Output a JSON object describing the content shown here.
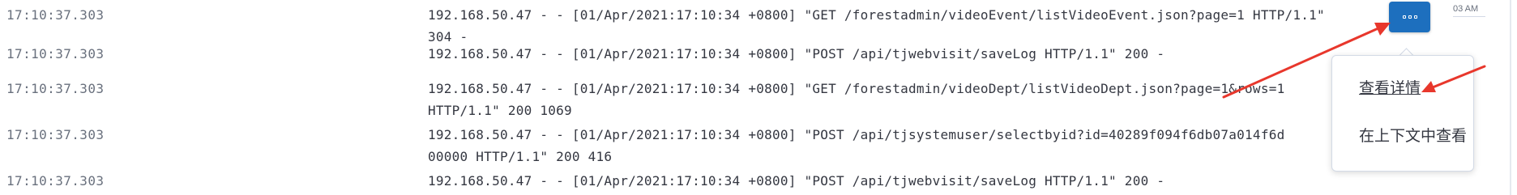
{
  "rows": [
    {
      "timestamp": "17:10:37.303",
      "message": "192.168.50.47 - - [01/Apr/2021:17:10:34 +0800] \"GET /forestadmin/videoEvent/listVideoEvent.json?page=1 HTTP/1.1\"\n304 -"
    },
    {
      "timestamp": "17:10:37.303",
      "message": "192.168.50.47 - - [01/Apr/2021:17:10:34 +0800] \"POST /api/tjwebvisit/saveLog HTTP/1.1\" 200 -"
    },
    {
      "timestamp": "17:10:37.303",
      "message": "192.168.50.47 - - [01/Apr/2021:17:10:34 +0800] \"GET /forestadmin/videoDept/listVideoDept.json?page=1&rows=1\nHTTP/1.1\" 200 1069"
    },
    {
      "timestamp": "17:10:37.303",
      "message": "192.168.50.47 - - [01/Apr/2021:17:10:34 +0800] \"POST /api/tjsystemuser/selectbyid?id=40289f094f6db07a014f6d\n00000 HTTP/1.1\" 200 416"
    },
    {
      "timestamp": "17:10:37.303",
      "message": "192.168.50.47 - - [01/Apr/2021:17:10:34 +0800] \"POST /api/tjwebvisit/saveLog HTTP/1.1\" 200 -"
    }
  ],
  "timeline": {
    "label": "03 AM"
  },
  "actions": {
    "button_icon": "more-dots-icon"
  },
  "popover": {
    "items": [
      {
        "label": "查看详情"
      },
      {
        "label": "在上下文中查看"
      }
    ]
  },
  "colors": {
    "accent": "#1d6fbe",
    "annotation_arrow": "#e8372c",
    "timestamp": "#69707d",
    "text": "#343741"
  }
}
